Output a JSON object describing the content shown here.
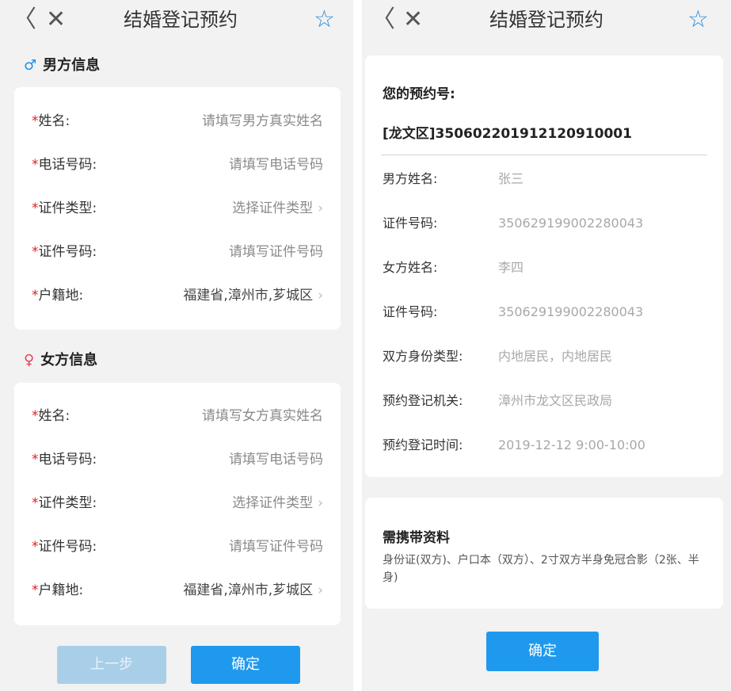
{
  "left": {
    "nav": {
      "back": "〈",
      "close": "✕",
      "title": "结婚登记预约",
      "star": "☆"
    },
    "male": {
      "symbol": "♂",
      "title": "男方信息",
      "rows": [
        {
          "required": "*",
          "label": "姓名:",
          "value": "请填写男方真实姓名"
        },
        {
          "required": "*",
          "label": "电话号码:",
          "value": "请填写电话号码"
        },
        {
          "required": "*",
          "label": "证件类型:",
          "value": "选择证件类型",
          "chevron": "›"
        },
        {
          "required": "*",
          "label": "证件号码:",
          "value": "请填写证件号码"
        },
        {
          "required": "*",
          "label": "户籍地:",
          "value": "福建省,漳州市,芗城区",
          "chevron": "›"
        }
      ]
    },
    "female": {
      "symbol": "♀",
      "title": "女方信息",
      "rows": [
        {
          "required": "*",
          "label": "姓名:",
          "value": "请填写女方真实姓名"
        },
        {
          "required": "*",
          "label": "电话号码:",
          "value": "请填写电话号码"
        },
        {
          "required": "*",
          "label": "证件类型:",
          "value": "选择证件类型",
          "chevron": "›"
        },
        {
          "required": "*",
          "label": "证件号码:",
          "value": "请填写证件号码"
        },
        {
          "required": "*",
          "label": "户籍地:",
          "value": "福建省,漳州市,芗城区",
          "chevron": "›"
        }
      ]
    },
    "buttons": {
      "prev": "上一步",
      "confirm": "确定"
    }
  },
  "right": {
    "nav": {
      "back": "〈",
      "close": "✕",
      "title": "结婚登记预约",
      "star": "☆"
    },
    "booking": {
      "number_label": "您的预约号:",
      "number": "[龙文区]35060220191212091000 1",
      "details": [
        {
          "label": "男方姓名:",
          "value": "张三"
        },
        {
          "label": "证件号码:",
          "value": "350629199002280043"
        },
        {
          "label": "女方姓名:",
          "value": "李四"
        },
        {
          "label": "证件号码:",
          "value": "350629199002280043"
        },
        {
          "label": "双方身份类型:",
          "value": "内地居民，内地居民"
        },
        {
          "label": "预约登记机关:",
          "value": "漳州市龙文区民政局"
        },
        {
          "label": "预约登记时间:",
          "value": "2019-12-12 9:00-10:00"
        }
      ]
    },
    "materials": {
      "title": "需携带资料",
      "text": "身份证(双方)、户口本（双方）、2寸双方半身免冠合影（2张、半身)"
    },
    "confirm": "确定"
  },
  "colors": {
    "accent": "#1f99ee",
    "required": "#e02020",
    "male": "#1d8fe6",
    "female": "#e8405a"
  }
}
